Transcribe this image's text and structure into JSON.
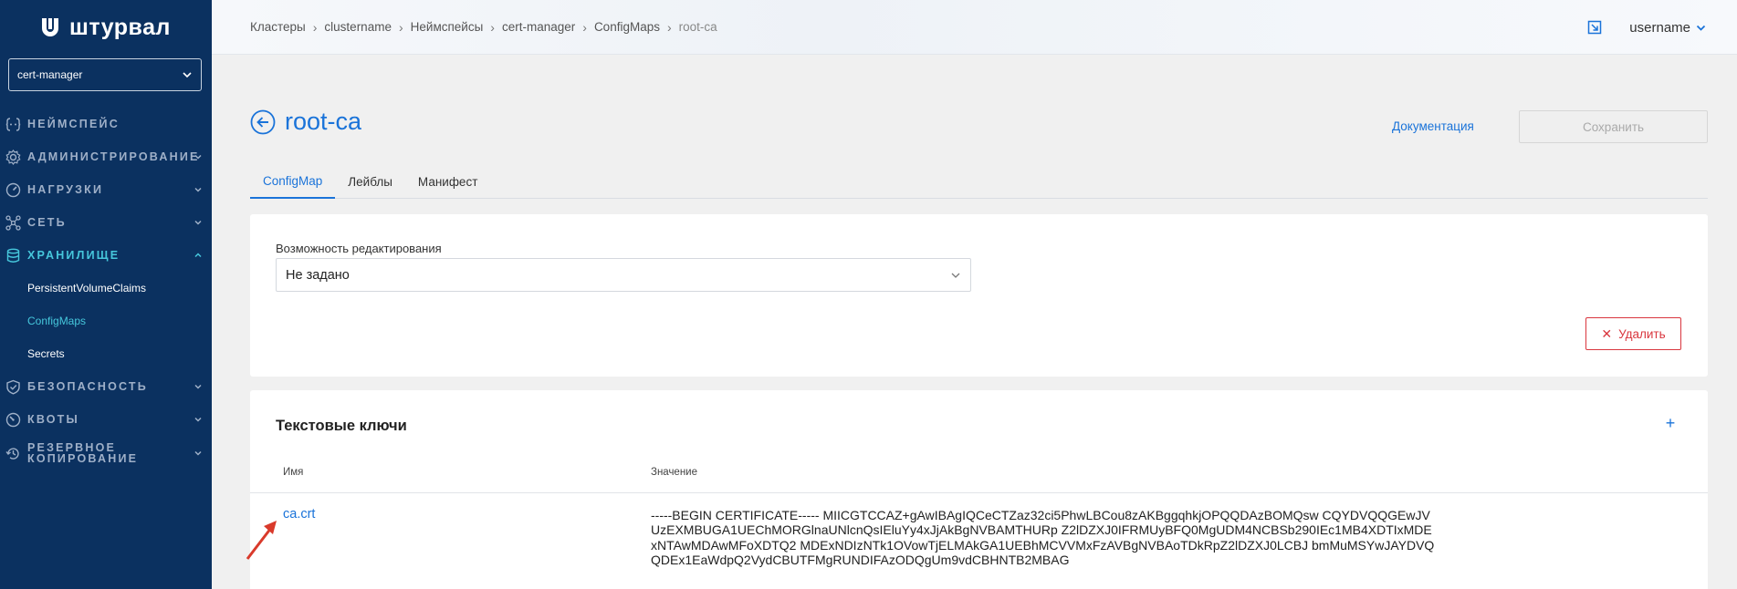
{
  "app": {
    "logo_text": "штурвал"
  },
  "sidebar": {
    "namespace_select": "cert-manager",
    "items": [
      {
        "label": "НЕЙМСПЕЙС",
        "icon": "namespace-icon",
        "has_caret": false
      },
      {
        "label": "АДМИНИСТРИРОВАНИЕ",
        "icon": "gear-icon",
        "has_caret": true
      },
      {
        "label": "НАГРУЗКИ",
        "icon": "speedometer-icon",
        "has_caret": true
      },
      {
        "label": "СЕТЬ",
        "icon": "network-icon",
        "has_caret": true
      },
      {
        "label": "ХРАНИЛИЩЕ",
        "icon": "database-icon",
        "has_caret": true,
        "active": true
      }
    ],
    "storage_sub": [
      "PersistentVolumeClaims",
      "ConfigMaps",
      "Secrets"
    ],
    "items_after": [
      {
        "label": "БЕЗОПАСНОСТЬ",
        "icon": "shield-icon"
      },
      {
        "label": "КВОТЫ",
        "icon": "gauge-icon"
      },
      {
        "label_line1": "РЕЗЕРВНОЕ",
        "label_line2": "КОПИРОВАНИЕ",
        "icon": "backup-icon"
      }
    ]
  },
  "breadcrumb": {
    "items": [
      "Кластеры",
      "clustername",
      "Неймспейсы",
      "cert-manager",
      "ConfigMaps"
    ],
    "current": "root-ca"
  },
  "user": {
    "name": "username"
  },
  "page": {
    "title": "root-ca",
    "doc_link": "Документация",
    "save_button": "Сохранить",
    "tabs": [
      "ConfigMap",
      "Лейблы",
      "Манифест"
    ],
    "active_tab": "ConfigMap"
  },
  "edit_card": {
    "label": "Возможность редактирования",
    "select_value": "Не задано",
    "delete_button": "Удалить"
  },
  "keys_card": {
    "title": "Текстовые ключи",
    "add_button": "+",
    "columns": [
      "Имя",
      "Значение"
    ],
    "rows": [
      {
        "name": "ca.crt",
        "value": "-----BEGIN CERTIFICATE----- MIICGTCCAZ+gAwIBAgIQCeCTZaz32ci5PhwLBCou8zAKBggqhkjOPQQDAzBOMQsw CQYDVQQGEwJVUzEXMBUGA1UEChMORGlnaUNlcnQsIEluYy4xJjAkBgNVBAMTHURp Z2lDZXJ0IFRMUyBFQ0MgUDM4NCBSb290IEc1MB4XDTIxMDExNTAwMDAwMFoXDTQ2 MDExNDIzNTk1OVowTjELMAkGA1UEBhMCVVMxFzAVBgNVBAoTDkRpZ2lDZXJ0LCBJ bmMuMSYwJAYDVQQDEx1EaWdpQ2VydCBUTFMgRUNDIFAzODQgUm9vdCBHNTB2MBAG"
      }
    ]
  },
  "colors": {
    "sidebar_bg": "#0b3160",
    "accent": "#1a73d9",
    "active_nav": "#46c7dc",
    "danger": "#d9363e"
  }
}
